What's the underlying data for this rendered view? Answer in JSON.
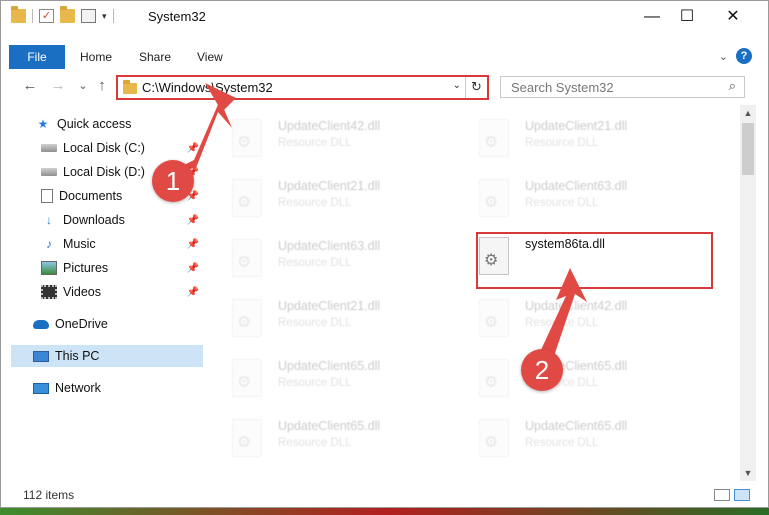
{
  "window": {
    "title": "System32",
    "minimize": "—",
    "maximize": "☐",
    "close": "✕"
  },
  "ribbon": {
    "tabs": [
      "File",
      "Home",
      "Share",
      "View"
    ],
    "help": "?",
    "collapse": "⌄"
  },
  "nav": {
    "back": "←",
    "forward": "→",
    "recent": "⌄",
    "up": "↑"
  },
  "address": {
    "path": "C:\\Windows\\System32",
    "dropdown": "⌄",
    "refresh": "↻"
  },
  "search": {
    "placeholder": "Search System32",
    "icon": "⌕"
  },
  "sidebar": {
    "items": [
      {
        "label": "Quick access",
        "icon": "star-icon",
        "glyph": "★",
        "pinned": false
      },
      {
        "label": "Local Disk (C:)",
        "icon": "drive-icon",
        "glyph": "",
        "pinned": true
      },
      {
        "label": "Local Disk (D:)",
        "icon": "drive-icon",
        "glyph": "",
        "pinned": true
      },
      {
        "label": "Documents",
        "icon": "documents-icon",
        "glyph": "",
        "pinned": true
      },
      {
        "label": "Downloads",
        "icon": "download-icon",
        "glyph": "↓",
        "pinned": true
      },
      {
        "label": "Music",
        "icon": "music-icon",
        "glyph": "♪",
        "pinned": true
      },
      {
        "label": "Pictures",
        "icon": "pictures-icon",
        "glyph": "",
        "pinned": true
      },
      {
        "label": "Videos",
        "icon": "videos-icon",
        "glyph": "",
        "pinned": true
      },
      {
        "label": "OneDrive",
        "icon": "onedrive-icon",
        "glyph": "",
        "pinned": false
      },
      {
        "label": "This PC",
        "icon": "computer-icon",
        "glyph": "",
        "pinned": false,
        "selected": true
      },
      {
        "label": "Network",
        "icon": "network-icon",
        "glyph": "",
        "pinned": false
      }
    ],
    "pin_glyph": "📌"
  },
  "files": {
    "column_left": [
      {
        "name": "UpdateClient42.dll",
        "type": "Resource DLL"
      },
      {
        "name": "UpdateClient21.dll",
        "type": "Resource DLL"
      },
      {
        "name": "UpdateClient63.dll",
        "type": "Resource DLL"
      },
      {
        "name": "UpdateClient21.dll",
        "type": "Resource DLL"
      },
      {
        "name": "UpdateClient65.dll",
        "type": "Resource DLL"
      },
      {
        "name": "UpdateClient65.dll",
        "type": "Resource DLL"
      }
    ],
    "column_right": [
      {
        "name": "UpdateClient21.dll",
        "type": "Resource DLL"
      },
      {
        "name": "UpdateClient63.dll",
        "type": "Resource DLL"
      },
      {
        "name": "system86ta.dll",
        "type": "",
        "highlighted": true
      },
      {
        "name": "UpdateClient42.dll",
        "type": "Resource DLL"
      },
      {
        "name": "UpdateClient65.dll",
        "type": "Resource DLL"
      },
      {
        "name": "UpdateClient65.dll",
        "type": "Resource DLL"
      }
    ]
  },
  "status": {
    "count": "112 items"
  },
  "annotations": {
    "step1": "1",
    "step2": "2",
    "color": "#e14a44"
  },
  "scroll": {
    "up": "▲",
    "down": "▼"
  }
}
